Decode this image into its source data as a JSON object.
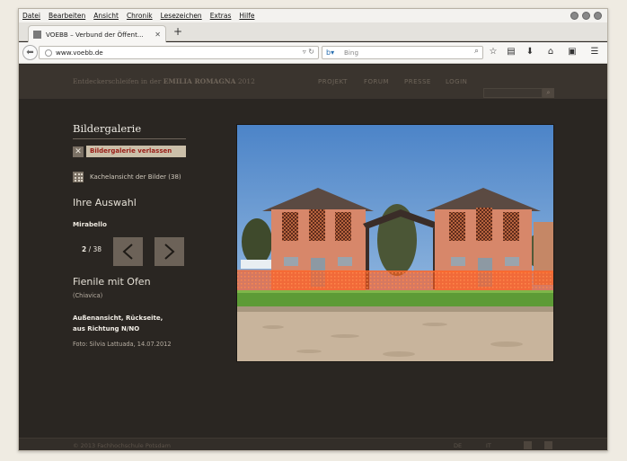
{
  "browser": {
    "menu": [
      "Datei",
      "Bearbeiten",
      "Ansicht",
      "Chronik",
      "Lesezeichen",
      "Extras",
      "Hilfe"
    ],
    "tab_title": "VOEBB – Verbund der Öffent...",
    "url": "www.voebb.de",
    "search_placeholder": "Bing"
  },
  "site": {
    "breadcrumb_prefix": "Entdeckerschleifen in der",
    "breadcrumb_region": "EMILIA ROMAGNA",
    "breadcrumb_year": "2012",
    "nav": [
      "PROJEKT",
      "FORUM",
      "PRESSE",
      "LOGIN"
    ]
  },
  "gallery": {
    "title": "Bildergalerie",
    "leave_label": "Bildergalerie verlassen",
    "tiles_label": "Kachelansicht der Bilder (38)",
    "selection_heading": "Ihre Auswahl",
    "selection_name": "Mirabello",
    "current": "2",
    "total": "/ 38"
  },
  "image": {
    "title": "Fienile mit Ofen",
    "subtitle": "(Chiavica)",
    "desc_line1": "Außenansicht, Rückseite,",
    "desc_line2": "aus Richtung N/NO",
    "credit": "Foto: Silvia Lattuada, 14.07.2012"
  },
  "footer": {
    "copyright": "© 2013",
    "org": "Fachhochschule Potsdam",
    "lang_de": "DE",
    "lang_it": "IT"
  }
}
